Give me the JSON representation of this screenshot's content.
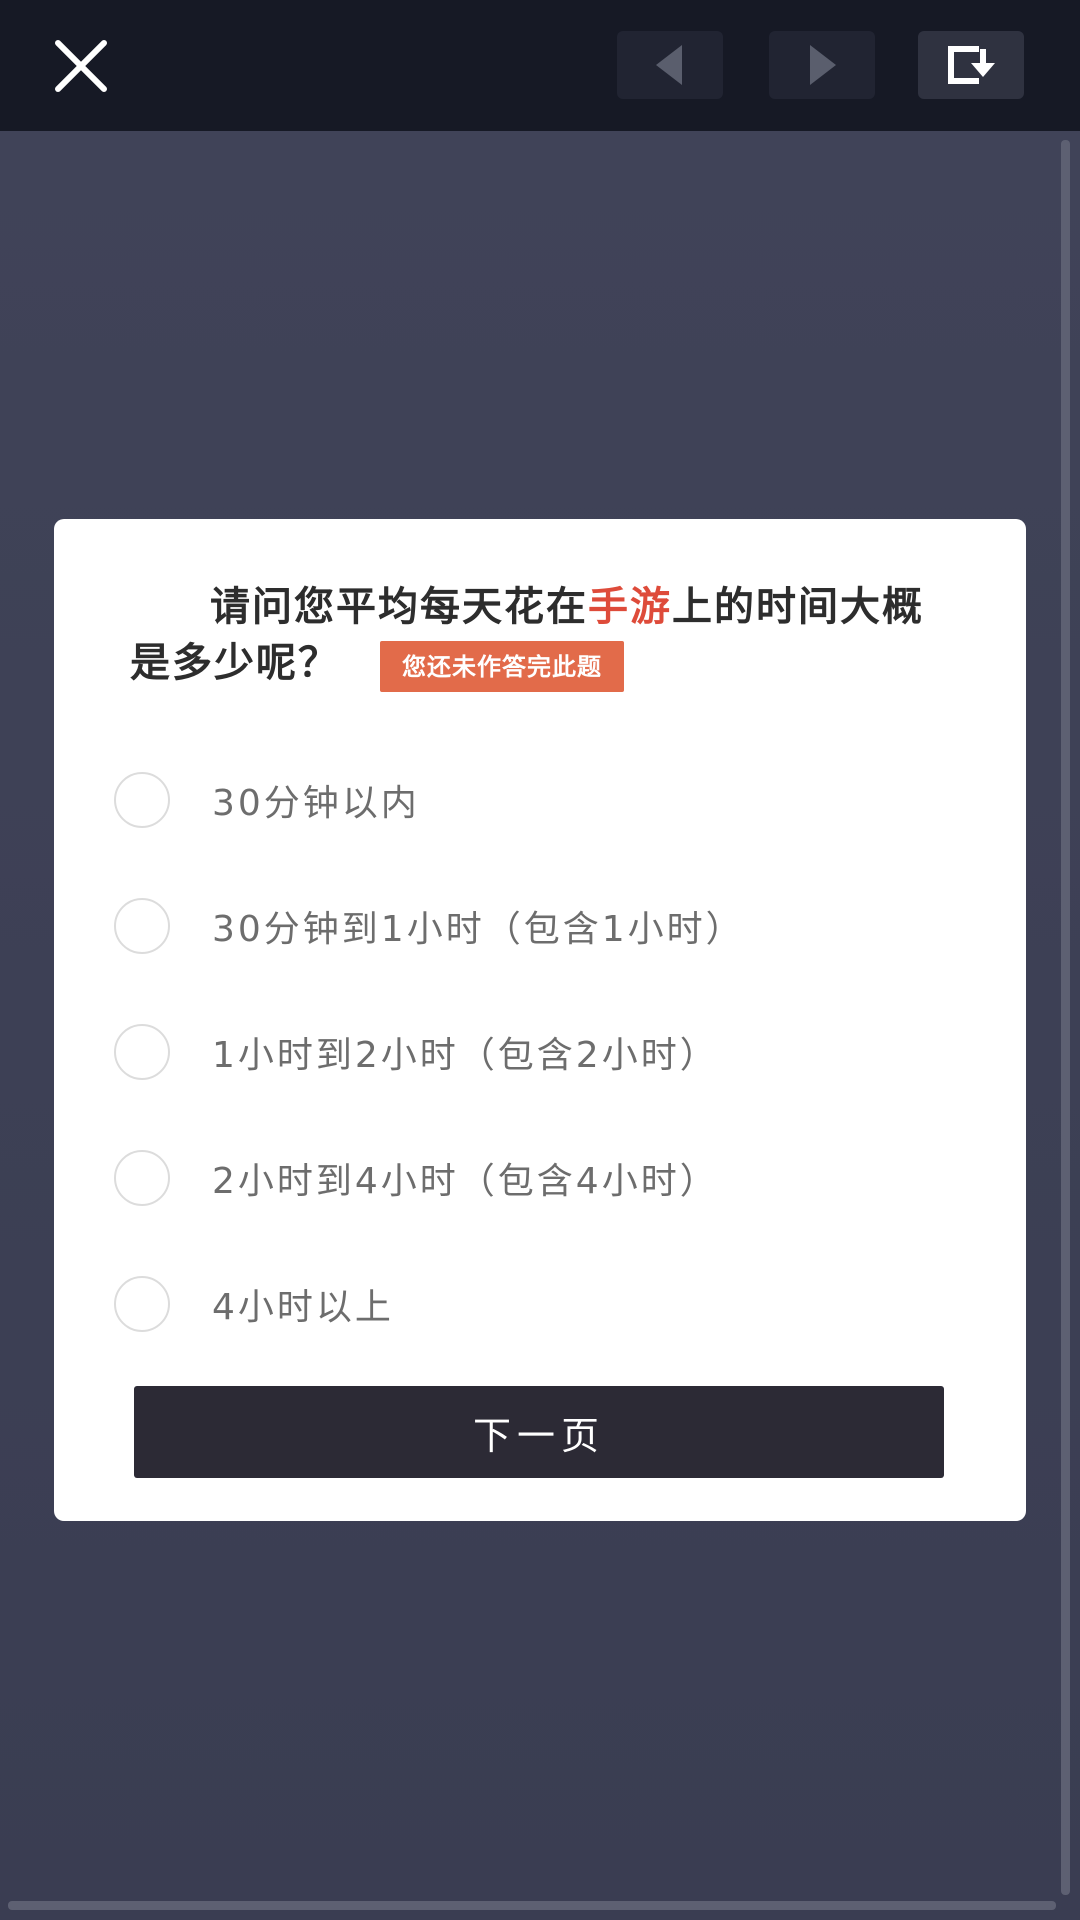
{
  "toolbar": {
    "close_icon": "close-icon",
    "prev_icon": "triangle-left-icon",
    "next_icon": "triangle-right-icon",
    "exit_icon": "exit-arrow-icon"
  },
  "question": {
    "text_before": "请问您平均每天花在",
    "text_highlight": "手游",
    "text_after": "上的时间大概是多少呢？",
    "highlight_color": "#de4b3a",
    "warning": "您还未作答完此题",
    "warning_color": "#e26b4a"
  },
  "options": [
    {
      "label": "30分钟以内"
    },
    {
      "label": "30分钟到1小时（包含1小时）"
    },
    {
      "label": "1小时到2小时（包含2小时）"
    },
    {
      "label": "2小时到4小时（包含4小时）"
    },
    {
      "label": "4小时以上"
    }
  ],
  "next_button": {
    "label": "下一页"
  }
}
